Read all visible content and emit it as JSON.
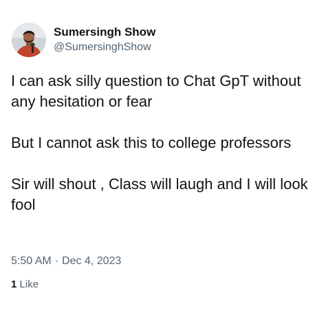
{
  "author": {
    "name": "Sumersingh Show",
    "handle": "@SumersinghShow",
    "avatar_icon": "profile-photo-icon"
  },
  "tweet": {
    "paragraphs": [
      "I can ask silly question to Chat GpT without any hesitation or fear",
      "But I cannot ask this to college professors",
      "Sir will shout , Class will laugh and I will look fool"
    ],
    "time": "5:50 AM",
    "separator": "·",
    "date": "Dec 4, 2023",
    "like_count": "1",
    "like_label": "Like"
  },
  "colors": {
    "text": "#0f1419",
    "secondary": "#536471",
    "background": "#ffffff"
  }
}
